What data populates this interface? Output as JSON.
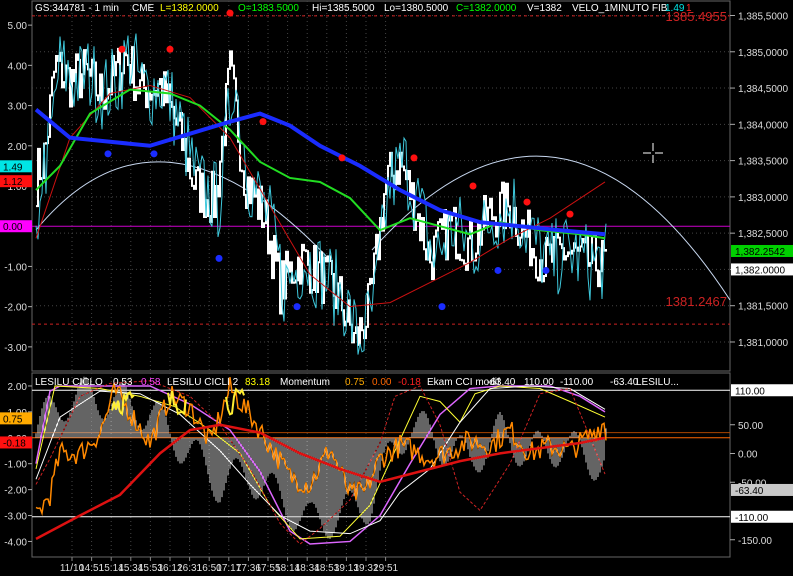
{
  "header": {
    "symbol": "GS:344781 - 1 min",
    "exchange": "CME",
    "last": "L=1382.0000",
    "open": "O=1383.5000",
    "high": "Hi=1385.5000",
    "low": "Lo=1380.5000",
    "close": "C=1382.0000",
    "volume": "V=1382",
    "study_name": "VELO_1MINUTO FIB",
    "study_v1": "1.49",
    "study_v2": "1"
  },
  "price_panel": {
    "right_axis_ticks": [
      "1,385,5000",
      "1,385,0000",
      "1,384,5000",
      "1,384,0000",
      "1,383,5000",
      "1,383,0000",
      "1,382,5000",
      "1,382,0000",
      "1,381,5000",
      "1,381,0000"
    ],
    "right_axis_tick_values": [
      1385.5,
      1385.0,
      1384.5,
      1384.0,
      1383.5,
      1383.0,
      1382.5,
      1382.0,
      1381.5,
      1381.0
    ],
    "right_range": [
      1380.6,
      1385.7
    ],
    "left_axis_ticks": [
      "5.00",
      "4.00",
      "3.00",
      "2.00",
      "1.00",
      "0.00",
      "-1.00",
      "-2.00",
      "-3.00"
    ],
    "left_axis_tick_values": [
      5,
      4,
      3,
      2,
      1,
      0,
      -1,
      -2,
      -3
    ],
    "left_range": [
      -3.6,
      5.6
    ],
    "top_level_label": "1385.4955",
    "top_level_value": 1385.4955,
    "bottom_level_label": "1381.2467",
    "bottom_level_value": 1381.2467,
    "left_badges": [
      {
        "text": "1.49",
        "value": 1.49,
        "color": "#00e5e5",
        "textcolor": "#000000"
      },
      {
        "text": "1.12",
        "value": 1.12,
        "color": "#ff1010",
        "textcolor": "#000000"
      },
      {
        "text": "0.00",
        "value": 0.0,
        "color": "#ff00ff",
        "textcolor": "#000000"
      }
    ],
    "right_badges": [
      {
        "text": "1,382.2542",
        "value": 1382.2542,
        "color": "#00d000",
        "textcolor": "#000000"
      },
      {
        "text": "1,382.0000",
        "value": 1382.0,
        "color": "#ffffff",
        "textcolor": "#000000"
      }
    ]
  },
  "osc_panel": {
    "legend": [
      {
        "text": "LESILU CICLO",
        "color": "#ffffff"
      },
      {
        "text": "0.53",
        "color": "#ffffff"
      },
      {
        "text": "0.58",
        "color": "#ff44ff"
      },
      {
        "text": "LESILU CICLI 2",
        "color": "#ffffff"
      },
      {
        "text": "83.18",
        "color": "#ffff00"
      },
      {
        "text": "Momentum",
        "color": "#ffffff"
      },
      {
        "text": "0.75",
        "color": "#ffaa00"
      },
      {
        "text": "0.00",
        "color": "#ff6600"
      },
      {
        "text": "-0.18",
        "color": "#ff2020"
      },
      {
        "text": "Ekam CCI modif",
        "color": "#ffffff"
      },
      {
        "text": "-63.40",
        "color": "#ffffff"
      },
      {
        "text": "110.00",
        "color": "#ffffff"
      },
      {
        "text": "-110.00",
        "color": "#ffffff"
      },
      {
        "text": "-63.40",
        "color": "#ffffff"
      },
      {
        "text": "LESILU...",
        "color": "#ffffff"
      }
    ],
    "left_axis_ticks": [
      "2.00",
      "1.00",
      "0.00",
      "-1.00",
      "-2.00",
      "-3.00",
      "-4.00"
    ],
    "left_axis_tick_values": [
      2,
      1,
      0,
      -1,
      -2,
      -3,
      -4
    ],
    "left_range": [
      -4.6,
      2.5
    ],
    "right_axis_ticks": [
      "50.00",
      "0.00",
      "-50.00",
      "-150.00"
    ],
    "right_axis_tick_values": [
      50,
      0,
      -50,
      -150
    ],
    "right_range": [
      -180,
      140
    ],
    "left_badges": [
      {
        "text": "0.75",
        "value": 0.75,
        "color": "#ffaa00",
        "textcolor": "#000000"
      },
      {
        "text": "-0.18",
        "value": -0.18,
        "color": "#ff1010",
        "textcolor": "#000000"
      }
    ],
    "right_badges": [
      {
        "text": "110.00",
        "value": 110,
        "color": "#ffffff",
        "textcolor": "#000000"
      },
      {
        "text": "-63.40",
        "value": -63.4,
        "color": "#c8c8c8",
        "textcolor": "#000000"
      },
      {
        "text": "-110.00",
        "value": -110,
        "color": "#ffffff",
        "textcolor": "#000000"
      }
    ]
  },
  "time_axis": [
    "11/10",
    "14:51",
    "15:14",
    "15:34",
    "15:53",
    "16:12",
    "16:31",
    "16:50",
    "17:17",
    "17:36",
    "17:55",
    "18:14",
    "18:34",
    "18:53",
    "19:13",
    "19:32",
    "19:51"
  ],
  "colors": {
    "price": "#ffffff",
    "fast": "#3ec8dc",
    "ma_blue": "#1a2cff",
    "ma_green": "#22dd22",
    "ma_red": "#cc1111",
    "dot_red": "#ff1010",
    "dot_blue": "#1a2cff",
    "grid": "#444444",
    "level_line": "#cc2222",
    "zero_line": "#cc00cc"
  },
  "cursor_icon": "crosshair-icon"
}
